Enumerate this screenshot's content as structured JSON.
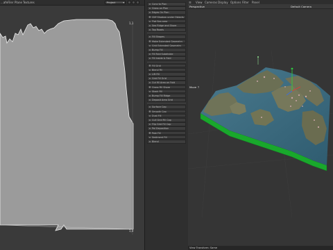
{
  "left_menu": {
    "items": [
      "...afeFiler",
      "Plane",
      "Textures"
    ]
  },
  "project_dropdown": {
    "value": "Project"
  },
  "uv_editor": {
    "corner_top_right": "1,1",
    "corner_bottom_right": "1,0"
  },
  "layers": {
    "group1": [
      "Conv to Plan",
      "Grass on Plan",
      "Edges On Plan",
      "Cliff Shadow under Objects",
      "Flat Sea area",
      "Sea Ridge and Shore",
      "Top Roads"
    ],
    "group2": [
      "Fill Shapes",
      "Make Extended Geometry",
      "Grid Extended Geometry",
      "Bump Fill",
      "Fill Fold Subdivide",
      "Fill Inside & Fold"
    ],
    "group3": [
      "Fill Grid",
      "Blend Fill",
      "Lift Fill",
      "Grid Fill Grid",
      "Cut fill Area on Fold",
      "Grass Fill Shore",
      "Stack Fill",
      "Bump Fill Ridge",
      "Deposit Area Grid"
    ],
    "group4": [
      "Surface Cap",
      "Smooth Cap",
      "Dust Fill",
      "Cull Grid Fill Cap",
      "Flip Grid Fill Cap",
      "Pal Deposition",
      "Pale Fill",
      "Sediment Fill",
      "Blend"
    ]
  },
  "viewport_menu": {
    "items": [
      "View",
      "Cameras",
      "Display",
      "Options",
      "Filter",
      "Panel"
    ]
  },
  "viewport": {
    "projection": "Perspective",
    "camera": "Default Camera",
    "gizmo_label": "Move ↑",
    "status": "View Transform: Same"
  },
  "colors": {
    "sea": "#3e6c82",
    "land": "#6f7358",
    "base": "#19a82c",
    "uv_fill": "#9b9b9b",
    "uv_bg": "#3a3a3a"
  }
}
